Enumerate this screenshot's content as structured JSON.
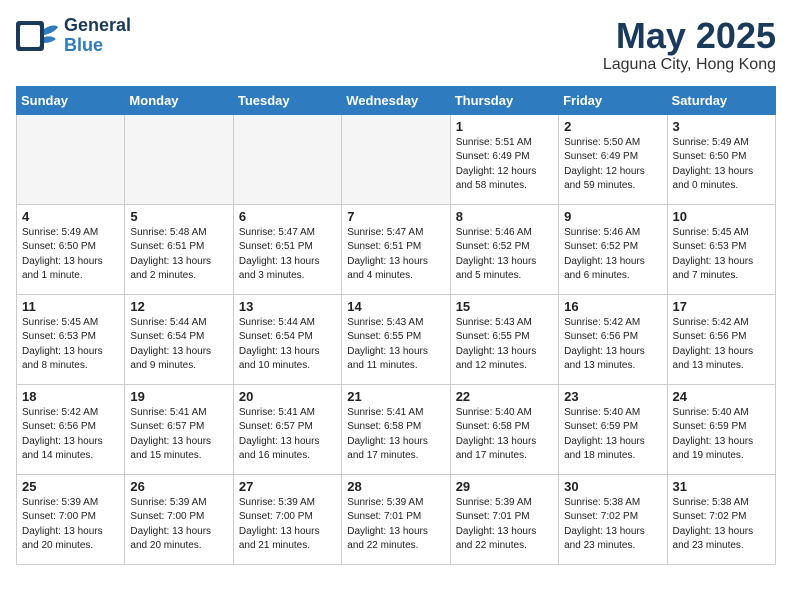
{
  "header": {
    "logo_general": "General",
    "logo_blue": "Blue",
    "month_year": "May 2025",
    "location": "Laguna City, Hong Kong"
  },
  "days_of_week": [
    "Sunday",
    "Monday",
    "Tuesday",
    "Wednesday",
    "Thursday",
    "Friday",
    "Saturday"
  ],
  "weeks": [
    [
      {
        "day": "",
        "sunrise": "",
        "sunset": "",
        "daylight": "",
        "empty": true
      },
      {
        "day": "",
        "sunrise": "",
        "sunset": "",
        "daylight": "",
        "empty": true
      },
      {
        "day": "",
        "sunrise": "",
        "sunset": "",
        "daylight": "",
        "empty": true
      },
      {
        "day": "",
        "sunrise": "",
        "sunset": "",
        "daylight": "",
        "empty": true
      },
      {
        "day": "1",
        "sunrise": "Sunrise: 5:51 AM",
        "sunset": "Sunset: 6:49 PM",
        "daylight": "Daylight: 12 hours and 58 minutes.",
        "empty": false
      },
      {
        "day": "2",
        "sunrise": "Sunrise: 5:50 AM",
        "sunset": "Sunset: 6:49 PM",
        "daylight": "Daylight: 12 hours and 59 minutes.",
        "empty": false
      },
      {
        "day": "3",
        "sunrise": "Sunrise: 5:49 AM",
        "sunset": "Sunset: 6:50 PM",
        "daylight": "Daylight: 13 hours and 0 minutes.",
        "empty": false
      }
    ],
    [
      {
        "day": "4",
        "sunrise": "Sunrise: 5:49 AM",
        "sunset": "Sunset: 6:50 PM",
        "daylight": "Daylight: 13 hours and 1 minute.",
        "empty": false
      },
      {
        "day": "5",
        "sunrise": "Sunrise: 5:48 AM",
        "sunset": "Sunset: 6:51 PM",
        "daylight": "Daylight: 13 hours and 2 minutes.",
        "empty": false
      },
      {
        "day": "6",
        "sunrise": "Sunrise: 5:47 AM",
        "sunset": "Sunset: 6:51 PM",
        "daylight": "Daylight: 13 hours and 3 minutes.",
        "empty": false
      },
      {
        "day": "7",
        "sunrise": "Sunrise: 5:47 AM",
        "sunset": "Sunset: 6:51 PM",
        "daylight": "Daylight: 13 hours and 4 minutes.",
        "empty": false
      },
      {
        "day": "8",
        "sunrise": "Sunrise: 5:46 AM",
        "sunset": "Sunset: 6:52 PM",
        "daylight": "Daylight: 13 hours and 5 minutes.",
        "empty": false
      },
      {
        "day": "9",
        "sunrise": "Sunrise: 5:46 AM",
        "sunset": "Sunset: 6:52 PM",
        "daylight": "Daylight: 13 hours and 6 minutes.",
        "empty": false
      },
      {
        "day": "10",
        "sunrise": "Sunrise: 5:45 AM",
        "sunset": "Sunset: 6:53 PM",
        "daylight": "Daylight: 13 hours and 7 minutes.",
        "empty": false
      }
    ],
    [
      {
        "day": "11",
        "sunrise": "Sunrise: 5:45 AM",
        "sunset": "Sunset: 6:53 PM",
        "daylight": "Daylight: 13 hours and 8 minutes.",
        "empty": false
      },
      {
        "day": "12",
        "sunrise": "Sunrise: 5:44 AM",
        "sunset": "Sunset: 6:54 PM",
        "daylight": "Daylight: 13 hours and 9 minutes.",
        "empty": false
      },
      {
        "day": "13",
        "sunrise": "Sunrise: 5:44 AM",
        "sunset": "Sunset: 6:54 PM",
        "daylight": "Daylight: 13 hours and 10 minutes.",
        "empty": false
      },
      {
        "day": "14",
        "sunrise": "Sunrise: 5:43 AM",
        "sunset": "Sunset: 6:55 PM",
        "daylight": "Daylight: 13 hours and 11 minutes.",
        "empty": false
      },
      {
        "day": "15",
        "sunrise": "Sunrise: 5:43 AM",
        "sunset": "Sunset: 6:55 PM",
        "daylight": "Daylight: 13 hours and 12 minutes.",
        "empty": false
      },
      {
        "day": "16",
        "sunrise": "Sunrise: 5:42 AM",
        "sunset": "Sunset: 6:56 PM",
        "daylight": "Daylight: 13 hours and 13 minutes.",
        "empty": false
      },
      {
        "day": "17",
        "sunrise": "Sunrise: 5:42 AM",
        "sunset": "Sunset: 6:56 PM",
        "daylight": "Daylight: 13 hours and 13 minutes.",
        "empty": false
      }
    ],
    [
      {
        "day": "18",
        "sunrise": "Sunrise: 5:42 AM",
        "sunset": "Sunset: 6:56 PM",
        "daylight": "Daylight: 13 hours and 14 minutes.",
        "empty": false
      },
      {
        "day": "19",
        "sunrise": "Sunrise: 5:41 AM",
        "sunset": "Sunset: 6:57 PM",
        "daylight": "Daylight: 13 hours and 15 minutes.",
        "empty": false
      },
      {
        "day": "20",
        "sunrise": "Sunrise: 5:41 AM",
        "sunset": "Sunset: 6:57 PM",
        "daylight": "Daylight: 13 hours and 16 minutes.",
        "empty": false
      },
      {
        "day": "21",
        "sunrise": "Sunrise: 5:41 AM",
        "sunset": "Sunset: 6:58 PM",
        "daylight": "Daylight: 13 hours and 17 minutes.",
        "empty": false
      },
      {
        "day": "22",
        "sunrise": "Sunrise: 5:40 AM",
        "sunset": "Sunset: 6:58 PM",
        "daylight": "Daylight: 13 hours and 17 minutes.",
        "empty": false
      },
      {
        "day": "23",
        "sunrise": "Sunrise: 5:40 AM",
        "sunset": "Sunset: 6:59 PM",
        "daylight": "Daylight: 13 hours and 18 minutes.",
        "empty": false
      },
      {
        "day": "24",
        "sunrise": "Sunrise: 5:40 AM",
        "sunset": "Sunset: 6:59 PM",
        "daylight": "Daylight: 13 hours and 19 minutes.",
        "empty": false
      }
    ],
    [
      {
        "day": "25",
        "sunrise": "Sunrise: 5:39 AM",
        "sunset": "Sunset: 7:00 PM",
        "daylight": "Daylight: 13 hours and 20 minutes.",
        "empty": false
      },
      {
        "day": "26",
        "sunrise": "Sunrise: 5:39 AM",
        "sunset": "Sunset: 7:00 PM",
        "daylight": "Daylight: 13 hours and 20 minutes.",
        "empty": false
      },
      {
        "day": "27",
        "sunrise": "Sunrise: 5:39 AM",
        "sunset": "Sunset: 7:00 PM",
        "daylight": "Daylight: 13 hours and 21 minutes.",
        "empty": false
      },
      {
        "day": "28",
        "sunrise": "Sunrise: 5:39 AM",
        "sunset": "Sunset: 7:01 PM",
        "daylight": "Daylight: 13 hours and 22 minutes.",
        "empty": false
      },
      {
        "day": "29",
        "sunrise": "Sunrise: 5:39 AM",
        "sunset": "Sunset: 7:01 PM",
        "daylight": "Daylight: 13 hours and 22 minutes.",
        "empty": false
      },
      {
        "day": "30",
        "sunrise": "Sunrise: 5:38 AM",
        "sunset": "Sunset: 7:02 PM",
        "daylight": "Daylight: 13 hours and 23 minutes.",
        "empty": false
      },
      {
        "day": "31",
        "sunrise": "Sunrise: 5:38 AM",
        "sunset": "Sunset: 7:02 PM",
        "daylight": "Daylight: 13 hours and 23 minutes.",
        "empty": false
      }
    ]
  ]
}
